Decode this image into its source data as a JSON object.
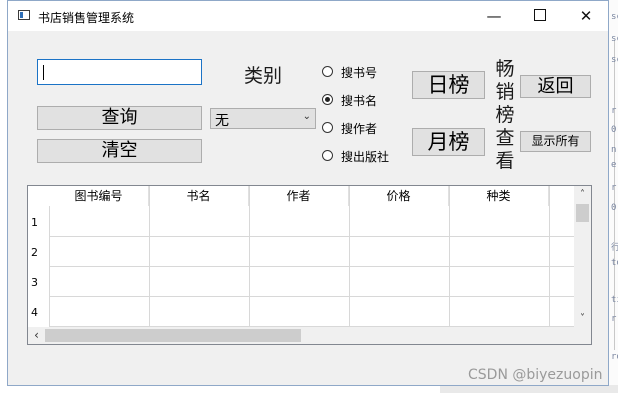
{
  "window": {
    "title": "书店销售管理系统"
  },
  "search": {
    "value": ""
  },
  "labels": {
    "category": "类别",
    "bestseller_vertical": [
      "畅",
      "销",
      "榜",
      "查",
      "看"
    ]
  },
  "buttons": {
    "query": "查询",
    "clear": "清空",
    "daily_rank": "日榜",
    "monthly_rank": "月榜",
    "back": "返回",
    "show_all": "显示所有"
  },
  "category_select": {
    "value": "无"
  },
  "radios": [
    {
      "label": "搜书号",
      "checked": false
    },
    {
      "label": "搜书名",
      "checked": true
    },
    {
      "label": "搜作者",
      "checked": false
    },
    {
      "label": "搜出版社",
      "checked": false
    }
  ],
  "table": {
    "columns": [
      "图书编号",
      "书名",
      "作者",
      "价格",
      "种类"
    ],
    "row_numbers": [
      "1",
      "2",
      "3",
      "4"
    ]
  },
  "watermark": "CSDN @biyezuopin",
  "background_glyphs": [
    "sc",
    "sc",
    "sc",
    "r",
    "0,",
    "n.",
    "e",
    "r",
    "0,",
    "行",
    "to",
    "ti",
    "r",
    "ro"
  ]
}
